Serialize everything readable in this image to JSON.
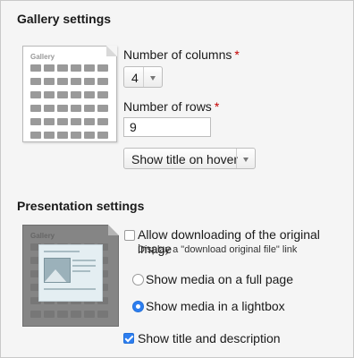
{
  "gallery_settings": {
    "title": "Gallery settings",
    "thumbnail_label": "Gallery",
    "columns_label": "Number of columns",
    "columns_value": "4",
    "rows_label": "Number of rows",
    "rows_value": "9",
    "title_display_value": "Show title on hover",
    "required_marker": "*"
  },
  "presentation_settings": {
    "title": "Presentation settings",
    "thumbnail_label": "Gallery",
    "allow_download_label": "Allow downloading of the original image",
    "allow_download_checked": false,
    "allow_download_hint": "Display a \"download original file\" link",
    "media_options": [
      {
        "label": "Show media on a full page",
        "selected": false
      },
      {
        "label": "Show media in a lightbox",
        "selected": true
      }
    ],
    "show_title_desc_label": "Show title and description",
    "show_title_desc_checked": true
  },
  "colors": {
    "accent": "#2d7ef0",
    "required": "#c40000"
  }
}
